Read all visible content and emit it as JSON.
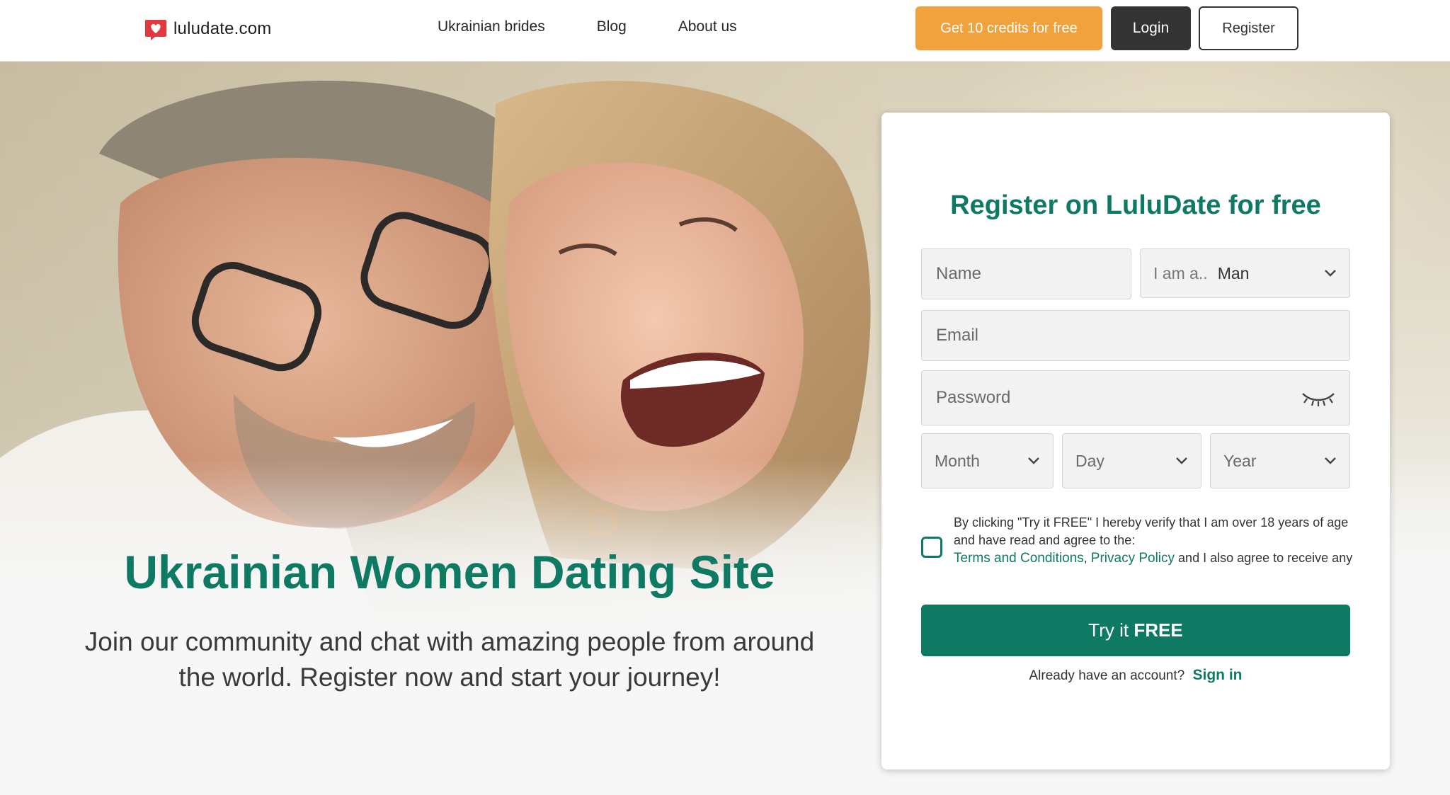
{
  "header": {
    "logo_text": "luludate.com",
    "nav": [
      "Ukrainian brides",
      "Blog",
      "About us"
    ],
    "credits_button": "Get 10 credits for free",
    "login_button": "Login",
    "register_button": "Register"
  },
  "hero": {
    "title": "Ukrainian Women Dating Site",
    "subtitle": "Join our community and chat with amazing people from around the world. Register now and start your journey!"
  },
  "form": {
    "title": "Register on LuluDate for free",
    "name_placeholder": "Name",
    "iam_label": "I am a..",
    "iam_value": "Man",
    "email_placeholder": "Email",
    "password_placeholder": "Password",
    "month_placeholder": "Month",
    "day_placeholder": "Day",
    "year_placeholder": "Year",
    "consent_before": "By clicking \"Try it FREE\" I hereby verify that I am over 18 years of age and have read and agree to the:",
    "terms_link": "Terms and Conditions",
    "privacy_link": "Privacy Policy",
    "consent_after": "and I also agree to receive any",
    "submit_prefix": "Try it",
    "submit_bold": "FREE",
    "signin_prompt": "Already have an account?",
    "signin_link": "Sign in"
  },
  "colors": {
    "brand_green": "#0f7a63",
    "credits_orange": "#f2a23c",
    "login_dark": "#333333",
    "logo_red": "#e0393e"
  },
  "icons": [
    "heart-logo-icon",
    "chevron-down-icon",
    "eye-closed-icon"
  ]
}
